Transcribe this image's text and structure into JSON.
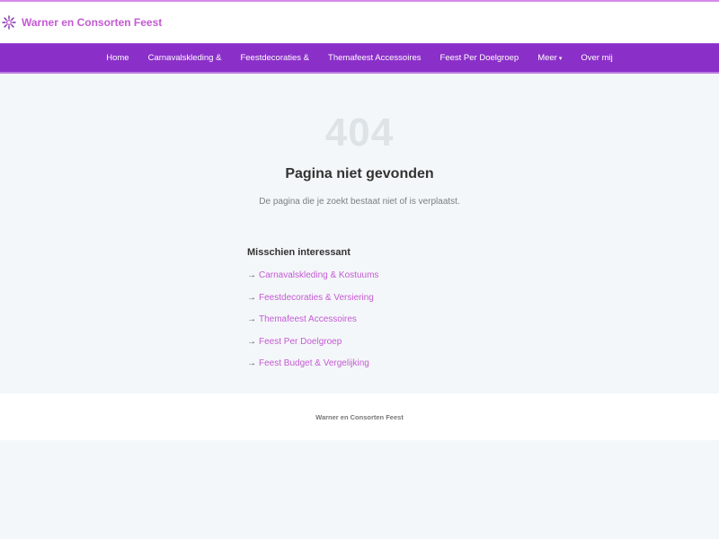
{
  "header": {
    "brand_name": "Warner en Consorten Feest",
    "brand_icon": "sun-sparkle-icon",
    "brand_color": "#c45ad4"
  },
  "nav": {
    "background": "#8b2fc9",
    "items": [
      {
        "label": "Home"
      },
      {
        "label": "Carnavalskleding &"
      },
      {
        "label": "Feestdecoraties &"
      },
      {
        "label": "Themafeest Accessoires"
      },
      {
        "label": "Feest Per Doelgroep"
      },
      {
        "label": "Meer",
        "caret": "▾"
      },
      {
        "label": "Over mij"
      }
    ]
  },
  "error": {
    "code": "404",
    "title": "Pagina niet gevonden",
    "description": "De pagina die je zoekt bestaat niet of is verplaatst."
  },
  "suggestions": {
    "heading": "Misschien interessant",
    "arrow": "→",
    "links": [
      {
        "label": "Carnavalskleding & Kostuums"
      },
      {
        "label": "Feestdecoraties & Versiering"
      },
      {
        "label": "Themafeest Accessoires"
      },
      {
        "label": "Feest Per Doelgroep"
      },
      {
        "label": "Feest Budget & Vergelijking"
      }
    ]
  },
  "footer": {
    "text": "Warner en Consorten Feest"
  }
}
